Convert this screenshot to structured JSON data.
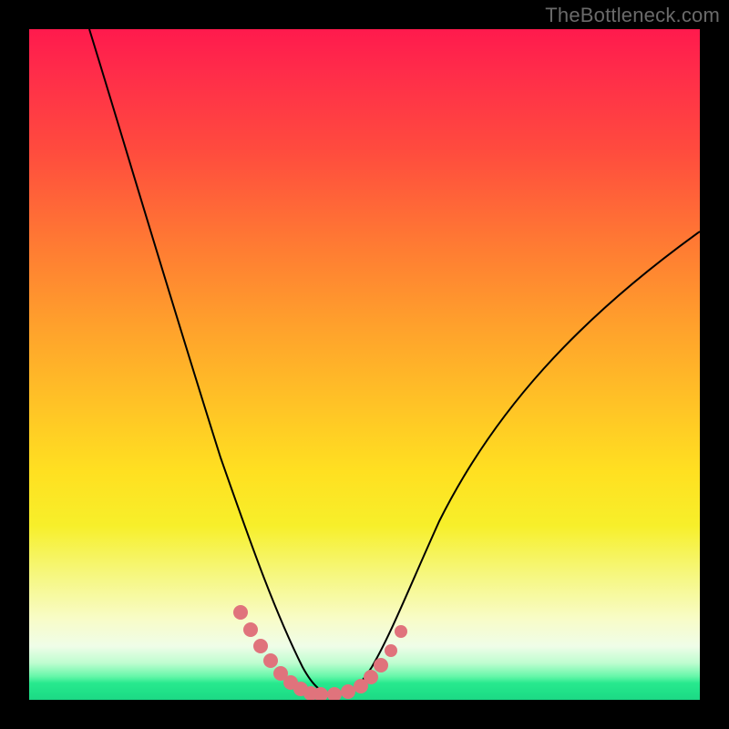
{
  "watermark": {
    "text": "TheBottleneck.com"
  },
  "colors": {
    "frame": "#000000",
    "curve_stroke": "#000000",
    "markers": "#e0737c",
    "gradient_top": "#ff1a4d",
    "gradient_bottom": "#1dd885"
  },
  "chart_data": {
    "type": "line",
    "title": "",
    "xlabel": "",
    "ylabel": "",
    "xlim": [
      0,
      100
    ],
    "ylim": [
      0,
      100
    ],
    "grid": false,
    "legend": false,
    "series": [
      {
        "name": "bottleneck-curve",
        "x": [
          9,
          12,
          16,
          20,
          24,
          28,
          31,
          34,
          36,
          38,
          40,
          42,
          44,
          46,
          50,
          52,
          56,
          60,
          66,
          74,
          82,
          90,
          100
        ],
        "y": [
          100,
          90,
          78,
          66,
          54,
          42,
          32,
          24,
          18,
          12,
          7,
          3,
          1,
          1,
          2,
          5,
          12,
          20,
          30,
          42,
          53,
          62,
          70
        ]
      }
    ],
    "annotations": [
      {
        "name": "left-cluster-markers",
        "points_x": [
          31.5,
          33.0,
          34.5,
          36.0,
          37.5,
          39.0,
          40.5
        ],
        "points_y": [
          13.0,
          10.5,
          8.0,
          5.8,
          4.0,
          2.6,
          1.6
        ]
      },
      {
        "name": "valley-floor-markers",
        "points_x": [
          42.0,
          43.5,
          45.5,
          47.5,
          49.5
        ],
        "points_y": [
          1.0,
          0.8,
          0.8,
          1.2,
          2.0
        ]
      },
      {
        "name": "right-cluster-markers",
        "points_x": [
          51.0,
          52.5,
          54.0,
          55.5
        ],
        "points_y": [
          3.4,
          5.2,
          7.4,
          10.2
        ]
      }
    ]
  }
}
